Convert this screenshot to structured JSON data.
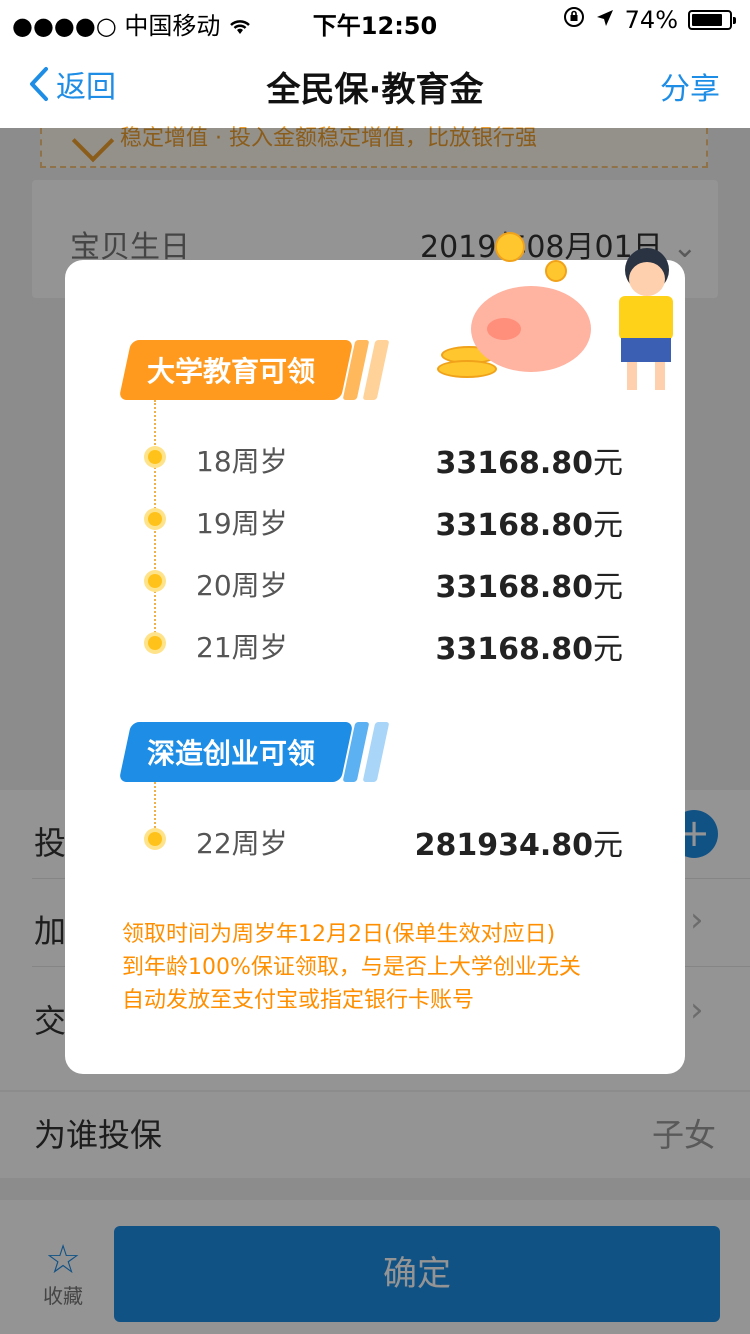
{
  "status_bar": {
    "signal": "●●●●○",
    "carrier": "中国移动",
    "time": "下午12:50",
    "battery": "74%"
  },
  "nav": {
    "back_label": "返回",
    "title": "全民保·教育金",
    "share_label": "分享"
  },
  "background": {
    "banner_text": "稳定增值 · 投入金额稳定增值，比放银行强",
    "birthday_label": "宝贝生日",
    "birthday_value": "2019年08月01日",
    "list_rows": [
      "投",
      "加",
      "交"
    ],
    "who_label": "为谁投保",
    "who_value": "子女",
    "favorite_label": "收藏",
    "confirm_label": "确定"
  },
  "modal": {
    "section1_title": "大学教育可领",
    "section1_rows": [
      {
        "age": "18周岁",
        "amount": "33168.80",
        "unit": "元"
      },
      {
        "age": "19周岁",
        "amount": "33168.80",
        "unit": "元"
      },
      {
        "age": "20周岁",
        "amount": "33168.80",
        "unit": "元"
      },
      {
        "age": "21周岁",
        "amount": "33168.80",
        "unit": "元"
      }
    ],
    "section2_title": "深造创业可领",
    "section2_rows": [
      {
        "age": "22周岁",
        "amount": "281934.80",
        "unit": "元"
      }
    ],
    "notes": [
      "领取时间为周岁年12月2日(保单生效对应日)",
      "到年龄100%保证领取，与是否上大学创业无关",
      "自动发放至支付宝或指定银行卡账号"
    ]
  },
  "colors": {
    "accent_blue": "#1e8de6",
    "accent_orange": "#ff9a1f",
    "note_orange": "#ff8f00"
  }
}
